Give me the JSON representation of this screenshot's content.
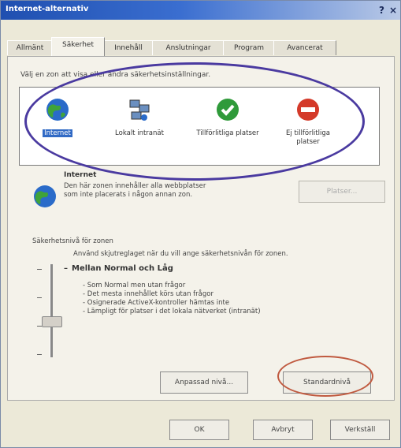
{
  "window": {
    "title": "Internet-alternativ",
    "help": "?",
    "close": "×"
  },
  "tabs": [
    {
      "label": "Allmänt"
    },
    {
      "label": "Säkerhet"
    },
    {
      "label": "Innehåll"
    },
    {
      "label": "Anslutningar"
    },
    {
      "label": "Program"
    },
    {
      "label": "Avancerat"
    }
  ],
  "zones_heading": "Välj en zon att visa eller ändra säkerhetsinställningar.",
  "zones": [
    {
      "label": "Internet",
      "icon": "globe-icon"
    },
    {
      "label": "Lokalt intranät",
      "icon": "intranet-icon"
    },
    {
      "label": "Tillförlitliga platser",
      "icon": "checkmark-icon"
    },
    {
      "label": "Ej tillförlitliga platser",
      "icon": "restricted-icon"
    }
  ],
  "zone_info": {
    "title": "Internet",
    "desc": "Den här zonen innehåller alla webbplatser som inte placerats i någon annan zon.",
    "sites_button": "Platser..."
  },
  "security_level": {
    "group_label": "Säkerhetsnivå för zonen",
    "hint": "Använd skjutreglaget när du vill ange säkerhetsnivån för zonen.",
    "name": "Mellan Normal och Låg",
    "bullets": [
      "- Som Normal men utan frågor",
      "- Det mesta innehållet körs utan frågor",
      "- Osignerade ActiveX-kontroller hämtas inte",
      "- Lämpligt för platser i det lokala nätverket (intranät)"
    ],
    "custom_button": "Anpassad nivå...",
    "default_button": "Standardnivå"
  },
  "buttons": {
    "ok": "OK",
    "cancel": "Avbryt",
    "apply": "Verkställ"
  },
  "colors": {
    "title_bar": "#1f4fb0",
    "selection": "#316ac5",
    "annotation_blue": "#4a3aa0",
    "annotation_red": "#c05a40"
  }
}
